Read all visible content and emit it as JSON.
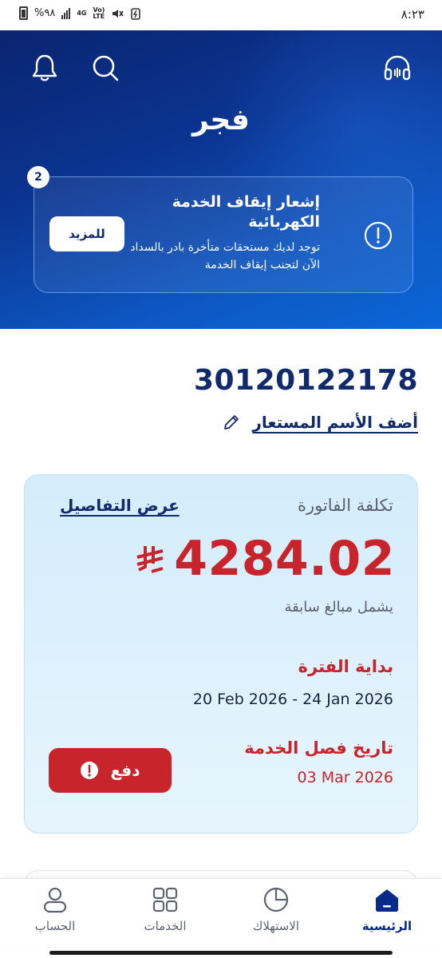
{
  "status_bar": {
    "time": "٨:٢٣",
    "battery": "%٩٨",
    "network_top": "4G",
    "network_vo": "Vo)",
    "network_lte": "LTE"
  },
  "header": {
    "user_name": "فجر",
    "icons": [
      "bell-icon",
      "search-icon",
      "headset-icon"
    ]
  },
  "notice": {
    "badge_count": "2",
    "title": "إشعار إيقاف الخدمة الكهربائية",
    "description": "توجد لديك مستحقات متأخرة بادر بالسداد الآن لتجنب إيقاف الخدمة",
    "more_label": "للمزيد"
  },
  "account": {
    "number": "30120122178",
    "alias_link": "أضف الأسم المستعار"
  },
  "bill": {
    "label": "تكلفة الفاتورة",
    "details_link": "عرض التفاصيل",
    "amount": "4284.02",
    "includes_note": "يشمل مبالغ سابقة",
    "period_label": "بداية الفترة",
    "period_value": "20 Feb 2026 - 24 Jan 2026",
    "disconnect_label": "تاريخ فصل الخدمة",
    "disconnect_date": "03 Mar 2026",
    "pay_label": "دفع"
  },
  "nav": {
    "home": "الرئيسية",
    "usage": "الاستهلاك",
    "services": "الخدمات",
    "account": "الحساب"
  },
  "colors": {
    "brand_dark_blue": "#0b2a72",
    "alert_red": "#c8242c",
    "card_bg": "#d4ecfb"
  }
}
